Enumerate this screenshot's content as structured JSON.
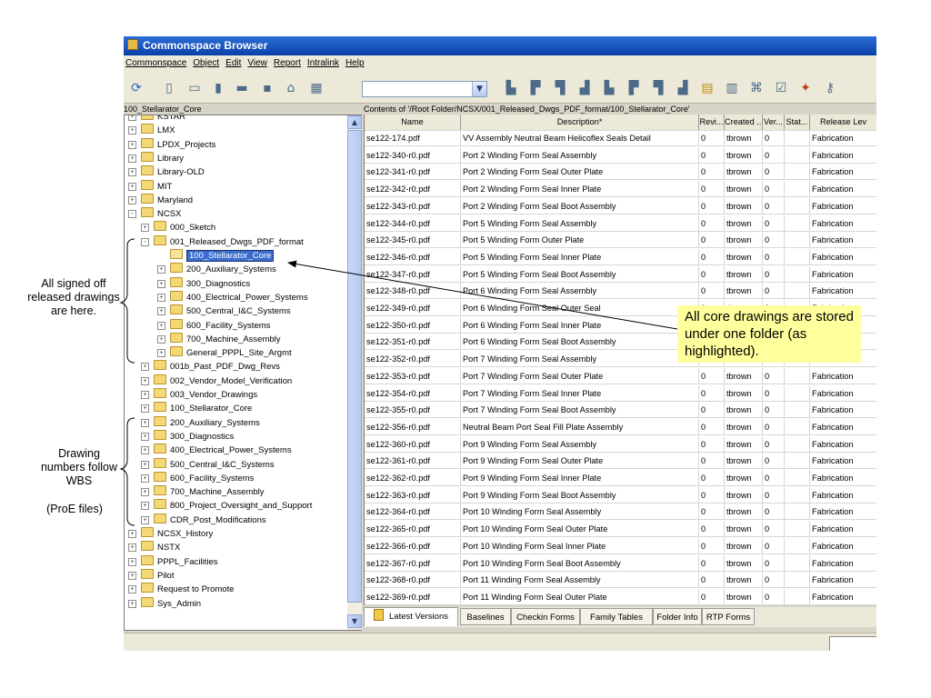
{
  "window": {
    "title": "Commonspace Browser"
  },
  "menu": [
    "Commonspace",
    "Object",
    "Edit",
    "View",
    "Report",
    "Intralink",
    "Help"
  ],
  "toolbar": {
    "icons_left": [
      "refresh-icon",
      "properties-icon",
      "workspace-icon",
      "checkin-icon",
      "checkout-icon",
      "move-icon",
      "home-icon",
      "columns-icon"
    ],
    "icons_right": [
      "folder-new-icon",
      "folder-up-icon",
      "folder-copy-icon",
      "folder-search-icon",
      "folder-tree-icon",
      "folder-move-icon",
      "folder-link-icon",
      "folder-delete-icon",
      "notes-icon",
      "inbox-icon",
      "binoculars-icon",
      "checklist-icon",
      "transfer-icon",
      "key-icon"
    ],
    "combo_value": ""
  },
  "left_panel": {
    "header": "100_Stellarator_Core"
  },
  "tree": [
    {
      "label": "KSTAR",
      "level": 0,
      "expander": "+"
    },
    {
      "label": "LMX",
      "level": 0,
      "expander": "+"
    },
    {
      "label": "LPDX_Projects",
      "level": 0,
      "expander": "+"
    },
    {
      "label": "Library",
      "level": 0,
      "expander": "+"
    },
    {
      "label": "Library-OLD",
      "level": 0,
      "expander": "+"
    },
    {
      "label": "MIT",
      "level": 0,
      "expander": "+"
    },
    {
      "label": "Maryland",
      "level": 0,
      "expander": "+"
    },
    {
      "label": "NCSX",
      "level": 0,
      "expander": "-"
    },
    {
      "label": "000_Sketch",
      "level": 1,
      "expander": "+"
    },
    {
      "label": "001_Released_Dwgs_PDF_format",
      "level": 1,
      "expander": "-"
    },
    {
      "label": "100_Stellarator_Core",
      "level": 2,
      "expander": "",
      "selected": true
    },
    {
      "label": "200_Auxiliary_Systems",
      "level": 2,
      "expander": "+"
    },
    {
      "label": "300_Diagnostics",
      "level": 2,
      "expander": "+"
    },
    {
      "label": "400_Electrical_Power_Systems",
      "level": 2,
      "expander": "+"
    },
    {
      "label": "500_Central_I&C_Systems",
      "level": 2,
      "expander": "+"
    },
    {
      "label": "600_Facility_Systems",
      "level": 2,
      "expander": "+"
    },
    {
      "label": "700_Machine_Assembly",
      "level": 2,
      "expander": "+"
    },
    {
      "label": "General_PPPL_Site_Argmt",
      "level": 2,
      "expander": "+"
    },
    {
      "label": "001b_Past_PDF_Dwg_Revs",
      "level": 1,
      "expander": "+"
    },
    {
      "label": "002_Vendor_Model_Verification",
      "level": 1,
      "expander": "+"
    },
    {
      "label": "003_Vendor_Drawings",
      "level": 1,
      "expander": "+"
    },
    {
      "label": "100_Stellarator_Core",
      "level": 1,
      "expander": "+"
    },
    {
      "label": "200_Auxiliary_Systems",
      "level": 1,
      "expander": "+"
    },
    {
      "label": "300_Diagnostics",
      "level": 1,
      "expander": "+"
    },
    {
      "label": "400_Electrical_Power_Systems",
      "level": 1,
      "expander": "+"
    },
    {
      "label": "500_Central_I&C_Systems",
      "level": 1,
      "expander": "+"
    },
    {
      "label": "600_Facility_Systems",
      "level": 1,
      "expander": "+"
    },
    {
      "label": "700_Machine_Assembly",
      "level": 1,
      "expander": "+"
    },
    {
      "label": "800_Project_Oversight_and_Support",
      "level": 1,
      "expander": "+"
    },
    {
      "label": "CDR_Post_Modifications",
      "level": 1,
      "expander": "+"
    },
    {
      "label": "NCSX_History",
      "level": 0,
      "expander": "+"
    },
    {
      "label": "NSTX",
      "level": 0,
      "expander": "+"
    },
    {
      "label": "PPPL_Facilities",
      "level": 0,
      "expander": "+"
    },
    {
      "label": "Pilot",
      "level": 0,
      "expander": "+"
    },
    {
      "label": "Request to Promote",
      "level": 0,
      "expander": "+"
    },
    {
      "label": "Sys_Admin",
      "level": 0,
      "expander": "+"
    }
  ],
  "right_panel": {
    "header": "Contents of '/Root Folder/NCSX/001_Released_Dwgs_PDF_format/100_Stellarator_Core'"
  },
  "table": {
    "columns": [
      "Name",
      "Description*",
      "Revi...",
      "Created ...",
      "Ver...",
      "Stat...",
      "Release Lev"
    ],
    "rows": [
      [
        "se122-174.pdf",
        "VV Assembly Neutral Beam Helicoflex Seals Detail",
        "0",
        "tbrown",
        "0",
        "",
        "Fabrication"
      ],
      [
        "se122-340-r0.pdf",
        "Port 2 Winding Form Seal Assembly",
        "0",
        "tbrown",
        "0",
        "",
        "Fabrication"
      ],
      [
        "se122-341-r0.pdf",
        "Port 2 Winding Form Seal Outer Plate",
        "0",
        "tbrown",
        "0",
        "",
        "Fabrication"
      ],
      [
        "se122-342-r0.pdf",
        "Port 2 Winding Form Seal Inner Plate",
        "0",
        "tbrown",
        "0",
        "",
        "Fabrication"
      ],
      [
        "se122-343-r0.pdf",
        "Port 2 Winding Form Seal Boot Assembly",
        "0",
        "tbrown",
        "0",
        "",
        "Fabrication"
      ],
      [
        "se122-344-r0.pdf",
        "Port 5 Winding Form Seal Assembly",
        "0",
        "tbrown",
        "0",
        "",
        "Fabrication"
      ],
      [
        "se122-345-r0.pdf",
        "Port 5 Winding Form Outer Plate",
        "0",
        "tbrown",
        "0",
        "",
        "Fabrication"
      ],
      [
        "se122-346-r0.pdf",
        "Port 5 Winding Form Seal Inner Plate",
        "0",
        "tbrown",
        "0",
        "",
        "Fabrication"
      ],
      [
        "se122-347-r0.pdf",
        "Port 5 Winding Form Seal Boot Assembly",
        "0",
        "tbrown",
        "0",
        "",
        "Fabrication"
      ],
      [
        "se122-348-r0.pdf",
        "Port 6 Winding Form Seal Assembly",
        "0",
        "tbrown",
        "0",
        "",
        "Fabrication"
      ],
      [
        "se122-349-r0.pdf",
        "Port 6 Winding Form Seal Outer Seal",
        "0",
        "tbrown",
        "0",
        "",
        "Fabrication"
      ],
      [
        "se122-350-r0.pdf",
        "Port 6 Winding Form Seal Inner Plate",
        "0",
        "tbrown",
        "0",
        "",
        "Fabrication"
      ],
      [
        "se122-351-r0.pdf",
        "Port 6 Winding Form Seal Boot Assembly",
        "0",
        "tbrown",
        "0",
        "",
        "Fabrication"
      ],
      [
        "se122-352-r0.pdf",
        "Port 7 Winding Form Seal Assembly",
        "0",
        "tbrown",
        "0",
        "",
        "Fabrication"
      ],
      [
        "se122-353-r0.pdf",
        "Port 7 Winding Form Seal Outer Plate",
        "0",
        "tbrown",
        "0",
        "",
        "Fabrication"
      ],
      [
        "se122-354-r0.pdf",
        "Port 7 Winding Form Seal Inner Plate",
        "0",
        "tbrown",
        "0",
        "",
        "Fabrication"
      ],
      [
        "se122-355-r0.pdf",
        "Port 7 Winding Form Seal Boot Assembly",
        "0",
        "tbrown",
        "0",
        "",
        "Fabrication"
      ],
      [
        "se122-356-r0.pdf",
        "Neutral Beam Port Seal Fill Plate Assembly",
        "0",
        "tbrown",
        "0",
        "",
        "Fabrication"
      ],
      [
        "se122-360-r0.pdf",
        "Port 9 Winding Form Seal Assembly",
        "0",
        "tbrown",
        "0",
        "",
        "Fabrication"
      ],
      [
        "se122-361-r0.pdf",
        "Port 9 Winding Form Seal Outer Plate",
        "0",
        "tbrown",
        "0",
        "",
        "Fabrication"
      ],
      [
        "se122-362-r0.pdf",
        "Port 9 Winding Form Seal Inner Plate",
        "0",
        "tbrown",
        "0",
        "",
        "Fabrication"
      ],
      [
        "se122-363-r0.pdf",
        "Port 9 Winding Form Seal Boot Assembly",
        "0",
        "tbrown",
        "0",
        "",
        "Fabrication"
      ],
      [
        "se122-364-r0.pdf",
        "Port 10 Winding Form Seal Assembly",
        "0",
        "tbrown",
        "0",
        "",
        "Fabrication"
      ],
      [
        "se122-365-r0.pdf",
        "Port 10 Winding Form Seal Outer Plate",
        "0",
        "tbrown",
        "0",
        "",
        "Fabrication"
      ],
      [
        "se122-366-r0.pdf",
        "Port 10 Winding Form Seal Inner Plate",
        "0",
        "tbrown",
        "0",
        "",
        "Fabrication"
      ],
      [
        "se122-367-r0.pdf",
        "Port 10 Winding Form Seal Boot Assembly",
        "0",
        "tbrown",
        "0",
        "",
        "Fabrication"
      ],
      [
        "se122-368-r0.pdf",
        "Port 11 Winding Form Seal Assembly",
        "0",
        "tbrown",
        "0",
        "",
        "Fabrication"
      ],
      [
        "se122-369-r0.pdf",
        "Port 11 Winding Form Seal Outer Plate",
        "0",
        "tbrown",
        "0",
        "",
        "Fabrication"
      ]
    ]
  },
  "tabs": [
    "Latest Versions",
    "Baselines",
    "Checkin Forms",
    "Family Tables",
    "Folder Info",
    "RTP Forms"
  ],
  "annotations": {
    "signed_off": "All signed off released drawings are here.",
    "wbs": "Drawing numbers follow WBS",
    "proe": "(ProE files)",
    "callout": "All core drawings are stored under one folder (as highlighted)."
  },
  "colors": {
    "callout_bg": "#ffff9e",
    "title_bar": "#0a3fa8",
    "selection": "#3a6ccf"
  }
}
